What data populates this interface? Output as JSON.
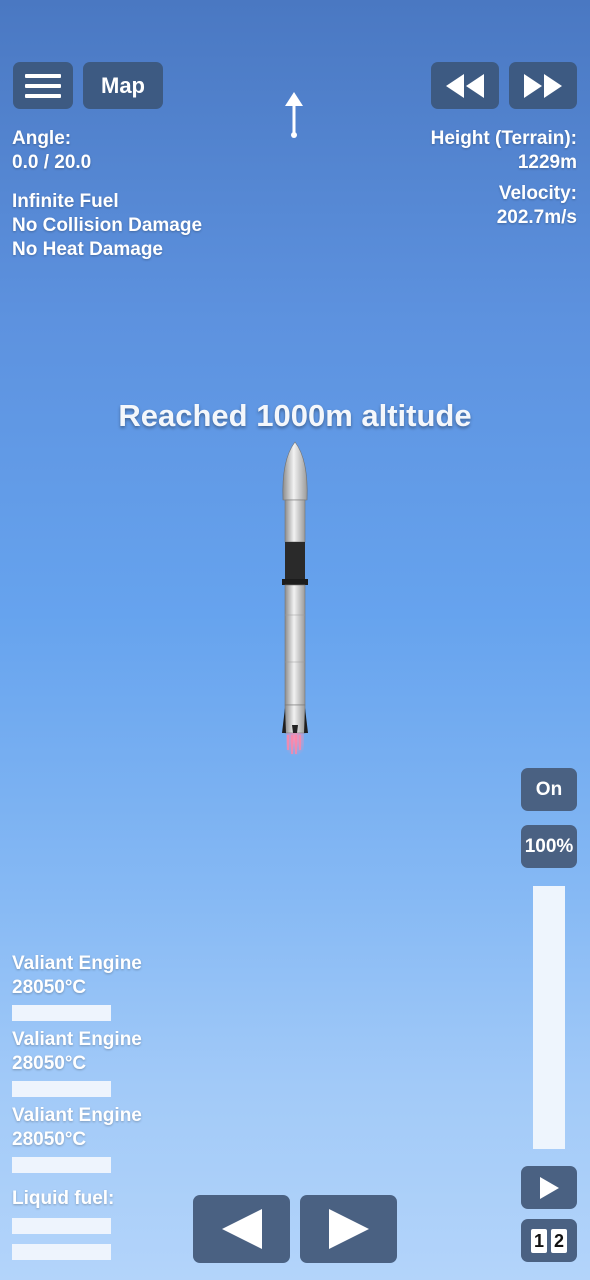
{
  "top": {
    "menu_icon": "hamburger-menu-icon",
    "map_label": "Map",
    "rewind_icon": "rewind-icon",
    "fastforward_icon": "fast-forward-icon",
    "prograde_icon": "up-arrow-icon"
  },
  "left_info": {
    "angle_label": "Angle:",
    "angle_value": "0.0 / 20.0",
    "cheats": [
      "Infinite Fuel",
      "No Collision Damage",
      "No Heat Damage"
    ]
  },
  "right_info": {
    "height_label": "Height (Terrain):",
    "height_value": "1229m",
    "velocity_label": "Velocity:",
    "velocity_value": "202.7m/s"
  },
  "message": "Reached 1000m altitude",
  "engines": [
    {
      "name": "Valiant Engine",
      "temp": "28050°C"
    },
    {
      "name": "Valiant Engine",
      "temp": "28050°C"
    },
    {
      "name": "Valiant Engine",
      "temp": "28050°C"
    }
  ],
  "fuel_label": "Liquid fuel:",
  "controls": {
    "engine_toggle": "On",
    "throttle_label": "100%",
    "throttle_level": 1.0,
    "play_icon": "play-icon",
    "left_icon": "rotate-left-icon",
    "right_icon": "rotate-right-icon",
    "stage_1": "1",
    "stage_2": "2"
  },
  "colors": {
    "button_bg": "#3d5a82",
    "sky_top": "#4a78c2",
    "sky_bottom": "#b3d4fa"
  }
}
